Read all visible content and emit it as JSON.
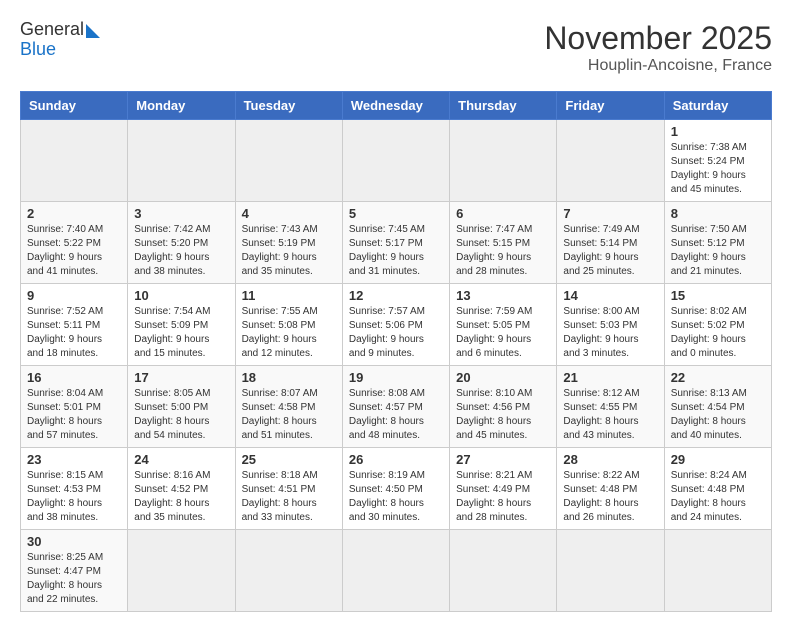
{
  "logo": {
    "line1": "General",
    "line2": "Blue"
  },
  "title": "November 2025",
  "subtitle": "Houplin-Ancoisne, France",
  "days_of_week": [
    "Sunday",
    "Monday",
    "Tuesday",
    "Wednesday",
    "Thursday",
    "Friday",
    "Saturday"
  ],
  "weeks": [
    [
      {
        "day": null,
        "info": null
      },
      {
        "day": null,
        "info": null
      },
      {
        "day": null,
        "info": null
      },
      {
        "day": null,
        "info": null
      },
      {
        "day": null,
        "info": null
      },
      {
        "day": null,
        "info": null
      },
      {
        "day": "1",
        "info": "Sunrise: 7:38 AM\nSunset: 5:24 PM\nDaylight: 9 hours and 45 minutes."
      }
    ],
    [
      {
        "day": "2",
        "info": "Sunrise: 7:40 AM\nSunset: 5:22 PM\nDaylight: 9 hours and 41 minutes."
      },
      {
        "day": "3",
        "info": "Sunrise: 7:42 AM\nSunset: 5:20 PM\nDaylight: 9 hours and 38 minutes."
      },
      {
        "day": "4",
        "info": "Sunrise: 7:43 AM\nSunset: 5:19 PM\nDaylight: 9 hours and 35 minutes."
      },
      {
        "day": "5",
        "info": "Sunrise: 7:45 AM\nSunset: 5:17 PM\nDaylight: 9 hours and 31 minutes."
      },
      {
        "day": "6",
        "info": "Sunrise: 7:47 AM\nSunset: 5:15 PM\nDaylight: 9 hours and 28 minutes."
      },
      {
        "day": "7",
        "info": "Sunrise: 7:49 AM\nSunset: 5:14 PM\nDaylight: 9 hours and 25 minutes."
      },
      {
        "day": "8",
        "info": "Sunrise: 7:50 AM\nSunset: 5:12 PM\nDaylight: 9 hours and 21 minutes."
      }
    ],
    [
      {
        "day": "9",
        "info": "Sunrise: 7:52 AM\nSunset: 5:11 PM\nDaylight: 9 hours and 18 minutes."
      },
      {
        "day": "10",
        "info": "Sunrise: 7:54 AM\nSunset: 5:09 PM\nDaylight: 9 hours and 15 minutes."
      },
      {
        "day": "11",
        "info": "Sunrise: 7:55 AM\nSunset: 5:08 PM\nDaylight: 9 hours and 12 minutes."
      },
      {
        "day": "12",
        "info": "Sunrise: 7:57 AM\nSunset: 5:06 PM\nDaylight: 9 hours and 9 minutes."
      },
      {
        "day": "13",
        "info": "Sunrise: 7:59 AM\nSunset: 5:05 PM\nDaylight: 9 hours and 6 minutes."
      },
      {
        "day": "14",
        "info": "Sunrise: 8:00 AM\nSunset: 5:03 PM\nDaylight: 9 hours and 3 minutes."
      },
      {
        "day": "15",
        "info": "Sunrise: 8:02 AM\nSunset: 5:02 PM\nDaylight: 9 hours and 0 minutes."
      }
    ],
    [
      {
        "day": "16",
        "info": "Sunrise: 8:04 AM\nSunset: 5:01 PM\nDaylight: 8 hours and 57 minutes."
      },
      {
        "day": "17",
        "info": "Sunrise: 8:05 AM\nSunset: 5:00 PM\nDaylight: 8 hours and 54 minutes."
      },
      {
        "day": "18",
        "info": "Sunrise: 8:07 AM\nSunset: 4:58 PM\nDaylight: 8 hours and 51 minutes."
      },
      {
        "day": "19",
        "info": "Sunrise: 8:08 AM\nSunset: 4:57 PM\nDaylight: 8 hours and 48 minutes."
      },
      {
        "day": "20",
        "info": "Sunrise: 8:10 AM\nSunset: 4:56 PM\nDaylight: 8 hours and 45 minutes."
      },
      {
        "day": "21",
        "info": "Sunrise: 8:12 AM\nSunset: 4:55 PM\nDaylight: 8 hours and 43 minutes."
      },
      {
        "day": "22",
        "info": "Sunrise: 8:13 AM\nSunset: 4:54 PM\nDaylight: 8 hours and 40 minutes."
      }
    ],
    [
      {
        "day": "23",
        "info": "Sunrise: 8:15 AM\nSunset: 4:53 PM\nDaylight: 8 hours and 38 minutes."
      },
      {
        "day": "24",
        "info": "Sunrise: 8:16 AM\nSunset: 4:52 PM\nDaylight: 8 hours and 35 minutes."
      },
      {
        "day": "25",
        "info": "Sunrise: 8:18 AM\nSunset: 4:51 PM\nDaylight: 8 hours and 33 minutes."
      },
      {
        "day": "26",
        "info": "Sunrise: 8:19 AM\nSunset: 4:50 PM\nDaylight: 8 hours and 30 minutes."
      },
      {
        "day": "27",
        "info": "Sunrise: 8:21 AM\nSunset: 4:49 PM\nDaylight: 8 hours and 28 minutes."
      },
      {
        "day": "28",
        "info": "Sunrise: 8:22 AM\nSunset: 4:48 PM\nDaylight: 8 hours and 26 minutes."
      },
      {
        "day": "29",
        "info": "Sunrise: 8:24 AM\nSunset: 4:48 PM\nDaylight: 8 hours and 24 minutes."
      }
    ],
    [
      {
        "day": "30",
        "info": "Sunrise: 8:25 AM\nSunset: 4:47 PM\nDaylight: 8 hours and 22 minutes."
      },
      {
        "day": null,
        "info": null
      },
      {
        "day": null,
        "info": null
      },
      {
        "day": null,
        "info": null
      },
      {
        "day": null,
        "info": null
      },
      {
        "day": null,
        "info": null
      },
      {
        "day": null,
        "info": null
      }
    ]
  ]
}
